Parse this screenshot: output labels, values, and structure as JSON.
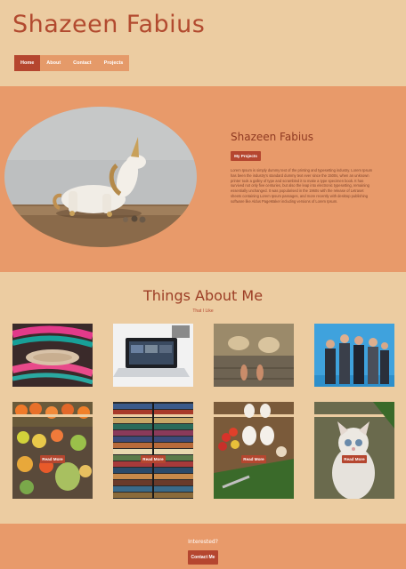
{
  "header": {
    "title": "Shazeen Fabius"
  },
  "nav": {
    "items": [
      {
        "label": "Home",
        "active": true
      },
      {
        "label": "About"
      },
      {
        "label": "Contact"
      },
      {
        "label": "Projects"
      }
    ]
  },
  "hero": {
    "name": "Shazeen Fabius",
    "button_label": "My Projects",
    "text": "Lorem Ipsum is simply dummy text of the printing and typesetting industry. Lorem Ipsum has been the industry's standard dummy text ever since the 1500s, when an unknown printer took a galley of type and scrambled it to make a type specimen book. It has survived not only five centuries, but also the leap into electronic typesetting, remaining essentially unchanged. It was popularised in the 1960s with the release of Letraset sheets containing Lorem Ipsum passages, and more recently with desktop publishing software like Aldus PageMaker including versions of Lorem Ipsum.",
    "image_icon": "unicorn-figurine-image"
  },
  "about": {
    "title": "Things About Me",
    "subtitle": "That I Like",
    "photos": [
      "bracelets-photo",
      "laptop-photo",
      "feet-on-deck-photo",
      "tv-show-cast-photo"
    ],
    "cards": [
      {
        "image": "vegetables-photo",
        "button_label": "Read More"
      },
      {
        "image": "books-photo",
        "button_label": "Read More"
      },
      {
        "image": "cooking-ingredients-photo",
        "button_label": "Read More"
      },
      {
        "image": "cat-photo",
        "button_label": "Read More"
      }
    ]
  },
  "footer": {
    "title": "Interested?",
    "button_label": "Contact Me"
  },
  "colors": {
    "background": "#eccca1",
    "accent": "#b5462f",
    "band": "#e89a6a"
  }
}
